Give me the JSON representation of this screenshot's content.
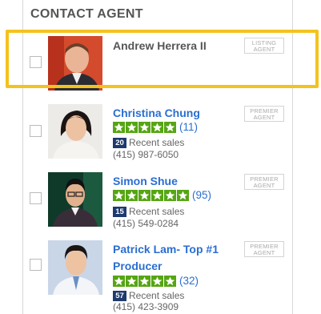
{
  "header": {
    "title": "CONTACT AGENT"
  },
  "agents": [
    {
      "name_line1": "Andrew Herrera II",
      "name_line2": "",
      "badge_line1": "LISTING",
      "badge_line2": "AGENT",
      "rating": "",
      "recent_sales_count": "",
      "recent_sales_label": "",
      "phone": "",
      "highlighted": true
    },
    {
      "name_line1": "Christina Chung",
      "name_line2": "",
      "badge_line1": "PREMIER",
      "badge_line2": "AGENT",
      "stars": 5,
      "rating": "(11)",
      "recent_sales_count": "20",
      "recent_sales_label": "Recent sales",
      "phone": "(415) 987-6050"
    },
    {
      "name_line1": "Simon Shue",
      "name_line2": "",
      "badge_line1": "PREMIER",
      "badge_line2": "AGENT",
      "stars": 5,
      "rating": "(95)",
      "recent_sales_count": "15",
      "recent_sales_label": "Recent sales",
      "phone": "(415) 549-0284"
    },
    {
      "name_line1": "Patrick Lam- Top #1",
      "name_line2": "Producer",
      "badge_line1": "PREMIER",
      "badge_line2": "AGENT",
      "stars": 5,
      "rating": "(32)",
      "recent_sales_count": "57",
      "recent_sales_label": "Recent sales",
      "phone": "(415) 423-3909"
    }
  ],
  "colors": {
    "link_blue": "#2a6ed1",
    "star_green": "#56a513",
    "highlight_yellow": "#f4c21d",
    "sales_badge": "#1e3a6e"
  }
}
